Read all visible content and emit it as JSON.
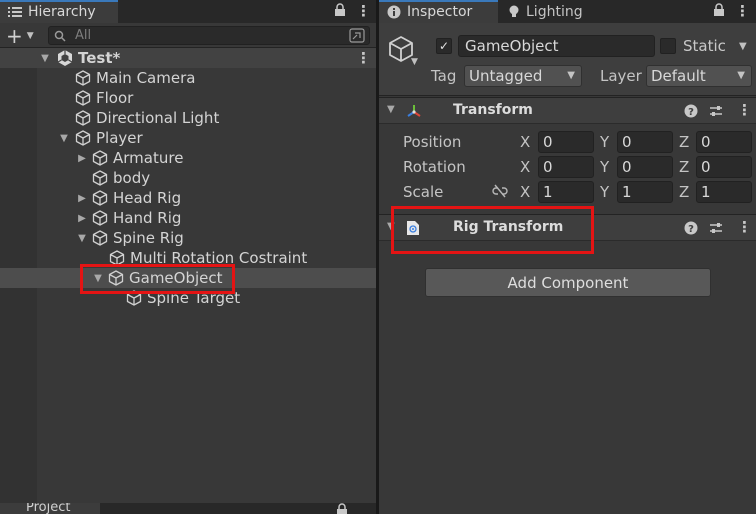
{
  "hierarchy": {
    "tab_label": "Hierarchy",
    "add_label": "+",
    "search_placeholder": "All",
    "scene": {
      "label": "Test*"
    },
    "items": [
      {
        "label": "Main Camera"
      },
      {
        "label": "Floor"
      },
      {
        "label": "Directional Light"
      },
      {
        "label": "Player"
      },
      {
        "label": "Armature"
      },
      {
        "label": "body"
      },
      {
        "label": "Head Rig"
      },
      {
        "label": "Hand Rig"
      },
      {
        "label": "Spine Rig"
      },
      {
        "label": "Multi Rotation Costraint"
      },
      {
        "label": "GameObject"
      },
      {
        "label": "Spine Target"
      }
    ],
    "bottom_tab_label": "Project"
  },
  "inspector": {
    "tab_label": "Inspector",
    "lighting_tab_label": "Lighting",
    "object_name": "GameObject",
    "static_label": "Static",
    "tag_label": "Tag",
    "tag_value": "Untagged",
    "layer_label": "Layer",
    "layer_value": "Default",
    "transform": {
      "title": "Transform",
      "position_label": "Position",
      "rotation_label": "Rotation",
      "scale_label": "Scale",
      "x_label": "X",
      "y_label": "Y",
      "z_label": "Z",
      "position": {
        "x": "0",
        "y": "0",
        "z": "0"
      },
      "rotation": {
        "x": "0",
        "y": "0",
        "z": "0"
      },
      "scale": {
        "x": "1",
        "y": "1",
        "z": "1"
      }
    },
    "rig_transform": {
      "title": "Rig Transform"
    },
    "add_component_label": "Add Component"
  },
  "colors": {
    "panel_bg": "#383838",
    "selected_row": "#4d4d4d",
    "highlight_box": "#e41414",
    "tab_accent": "#3a79bb"
  }
}
